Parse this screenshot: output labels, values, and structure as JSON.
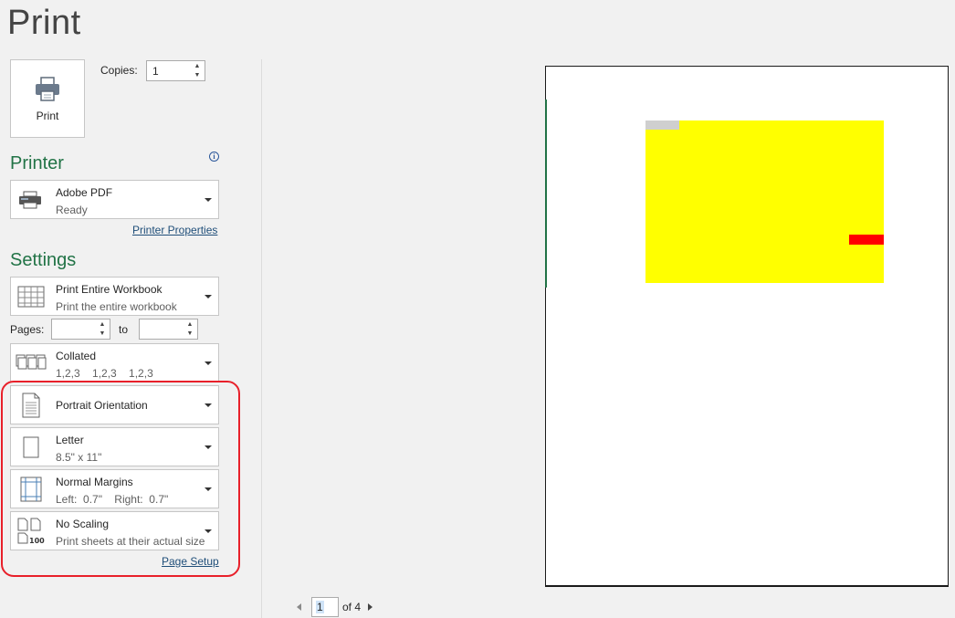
{
  "title": "Print",
  "print_button": {
    "label": "Print"
  },
  "copies": {
    "label": "Copies:",
    "value": "1"
  },
  "printer": {
    "heading": "Printer",
    "name": "Adobe PDF",
    "status": "Ready",
    "properties_link": "Printer Properties"
  },
  "settings": {
    "heading": "Settings",
    "print_what": {
      "title": "Print Entire Workbook",
      "subtitle": "Print the entire workbook"
    },
    "pages": {
      "label": "Pages:",
      "to_label": "to",
      "from_value": "",
      "to_value": ""
    },
    "collation": {
      "title": "Collated",
      "subtitle": "1,2,3    1,2,3    1,2,3"
    },
    "orientation": {
      "title": "Portrait Orientation"
    },
    "paper": {
      "title": "Letter",
      "subtitle": "8.5\" x 11\""
    },
    "margins": {
      "title": "Normal Margins",
      "subtitle": "Left:  0.7\"    Right:  0.7\""
    },
    "scaling": {
      "title": "No Scaling",
      "subtitle": "Print sheets at their actual size"
    },
    "page_setup_link": "Page Setup"
  },
  "preview": {
    "current_page": "1",
    "of_label": "of 4",
    "colors": {
      "fill": "#ffff00",
      "header_cell": "#cfcfcf",
      "marker": "#ff0000"
    }
  },
  "colors": {
    "accent": "#217346",
    "highlight": "#e8202a",
    "link": "#1f4e79"
  }
}
